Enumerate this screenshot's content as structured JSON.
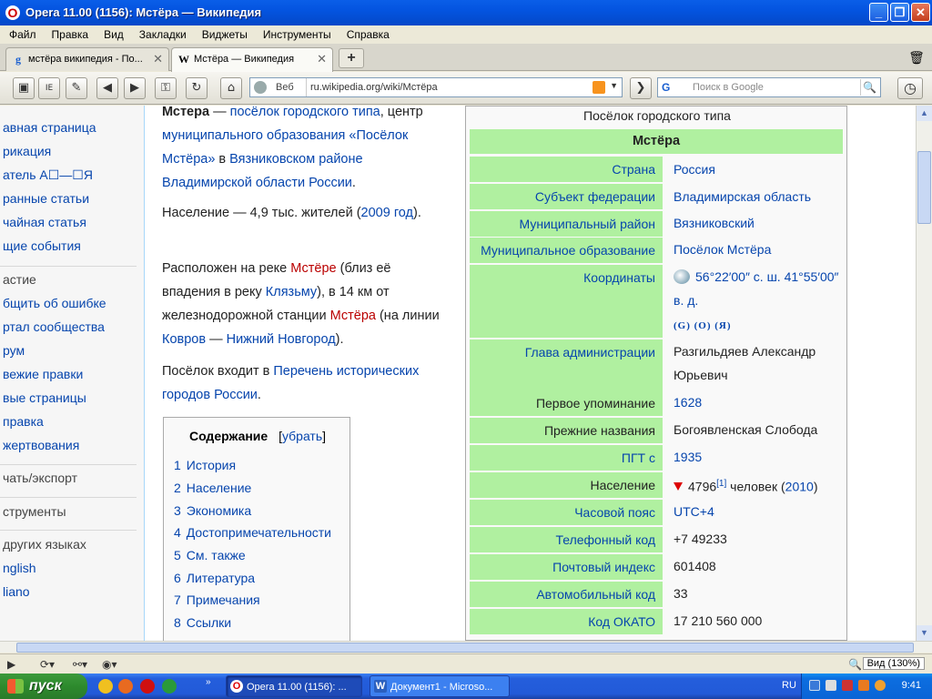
{
  "window": {
    "title": "Opera 11.00 (1156): Мстёра — Википедия"
  },
  "menu": [
    "Файл",
    "Правка",
    "Вид",
    "Закладки",
    "Виджеты",
    "Инструменты",
    "Справка"
  ],
  "tabs": [
    {
      "label": "мстёра википедия - По...",
      "active": false
    },
    {
      "label": "Мстёра — Википедия",
      "active": true
    }
  ],
  "nav": {
    "site_label": "Веб",
    "url": "ru.wikipedia.org/wiki/Мстёра",
    "search_placeholder": "Поиск в Google",
    "search_engine": "G"
  },
  "sidebar": {
    "items": [
      {
        "label": "авная страница",
        "kind": "link"
      },
      {
        "label": "рикация",
        "kind": "link"
      },
      {
        "label": "атель А☐—☐Я",
        "kind": "link"
      },
      {
        "label": "ранные статьи",
        "kind": "link"
      },
      {
        "label": "чайная статья",
        "kind": "link"
      },
      {
        "label": "щие события",
        "kind": "link"
      },
      {
        "label": "астие",
        "kind": "heading"
      },
      {
        "label": "бщить об ошибке",
        "kind": "link"
      },
      {
        "label": "ртал сообщества",
        "kind": "link"
      },
      {
        "label": "рум",
        "kind": "link"
      },
      {
        "label": "вежие правки",
        "kind": "link"
      },
      {
        "label": "вые страницы",
        "kind": "link"
      },
      {
        "label": "правка",
        "kind": "link"
      },
      {
        "label": "жертвования",
        "kind": "link"
      },
      {
        "label": "чать/экспорт",
        "kind": "heading"
      },
      {
        "label": "струменты",
        "kind": "heading"
      },
      {
        "label": "других языках",
        "kind": "heading"
      },
      {
        "label": "nglish",
        "kind": "link"
      },
      {
        "label": "liano",
        "kind": "link"
      }
    ]
  },
  "article": {
    "p1": {
      "title": "Мстера",
      "dash": " — ",
      "link1": "посёлок городского типа",
      "t1": ", центр ",
      "link2": "муниципального образования «Посёлок Мстёра»",
      "t2": " в ",
      "link3": "Вязниковском районе",
      "t3": " ",
      "link4": "Владимирской области",
      "t4": " ",
      "link5": "России",
      "t5": "."
    },
    "p2": {
      "t1": "Население — 4,9 тыс. жителей (",
      "link1": "2009 год",
      "t2": ")."
    },
    "p3": {
      "t1": "Расположен на реке ",
      "link1": "Мстёре",
      "t2": " (близ её впадения в реку ",
      "link2": "Клязьму",
      "t3": "), в 14 км от железнодорожной станции ",
      "link3": "Мстёра",
      "t4": " (на линии ",
      "link4": "Ковров",
      "t5": " — ",
      "link5": "Нижний Новгород",
      "t6": ")."
    },
    "p4": {
      "t1": "Посёлок входит в ",
      "link1": "Перечень исторических городов России",
      "t2": "."
    }
  },
  "toc": {
    "title": "Содержание",
    "hide": "убрать",
    "items": [
      {
        "num": "1",
        "label": "История"
      },
      {
        "num": "2",
        "label": "Население"
      },
      {
        "num": "3",
        "label": "Экономика"
      },
      {
        "num": "4",
        "label": "Достопримечательности"
      },
      {
        "num": "5",
        "label": "См. также"
      },
      {
        "num": "6",
        "label": "Литература"
      },
      {
        "num": "7",
        "label": "Примечания"
      },
      {
        "num": "8",
        "label": "Ссылки"
      }
    ]
  },
  "infobox": {
    "caption": "Посёлок городского типа",
    "name": "Мстёра",
    "rows": [
      {
        "label": "Страна",
        "value": "Россия"
      },
      {
        "label": "Субъект федерации",
        "value": "Владимирская область"
      },
      {
        "label": "Муниципальный район",
        "value": "Вязниковский"
      },
      {
        "label": "Муниципальное образование",
        "value": "Посёлок Мстёра"
      },
      {
        "label": "Координаты",
        "value": "56°22′00″ с. ш. 41°55′00″ в. д.",
        "extra": "(G) (O) (Я)"
      },
      {
        "label": "Глава администрации",
        "value": "Разгильдяев Александр Юрьевич"
      },
      {
        "label": "Первое упоминание",
        "value": "1628"
      },
      {
        "label": "Прежние названия",
        "value": "Богоявленская Слобода"
      },
      {
        "label": "ПГТ с",
        "value": "1935"
      },
      {
        "label": "Население",
        "value": "4796",
        "sup": "[1]",
        "unit": " человек (",
        "year": "2010",
        "close": ")"
      },
      {
        "label": "Часовой пояс",
        "value": "UTC+4"
      },
      {
        "label": "Телефонный код",
        "value": "+7 49233"
      },
      {
        "label": "Почтовый индекс",
        "value": "601408"
      },
      {
        "label": "Автомобильный код",
        "value": "33"
      },
      {
        "label": "Код ОКАТО",
        "value": "17 210 560 000"
      }
    ]
  },
  "status": {
    "zoom": "Вид (130%)"
  },
  "taskbar": {
    "start": "пуск",
    "tasks": [
      {
        "label": "Opera 11.00 (1156): ...",
        "active": true
      },
      {
        "label": "Документ1 - Microso...",
        "active": false
      }
    ],
    "lang": "RU",
    "clock": "9:41"
  }
}
